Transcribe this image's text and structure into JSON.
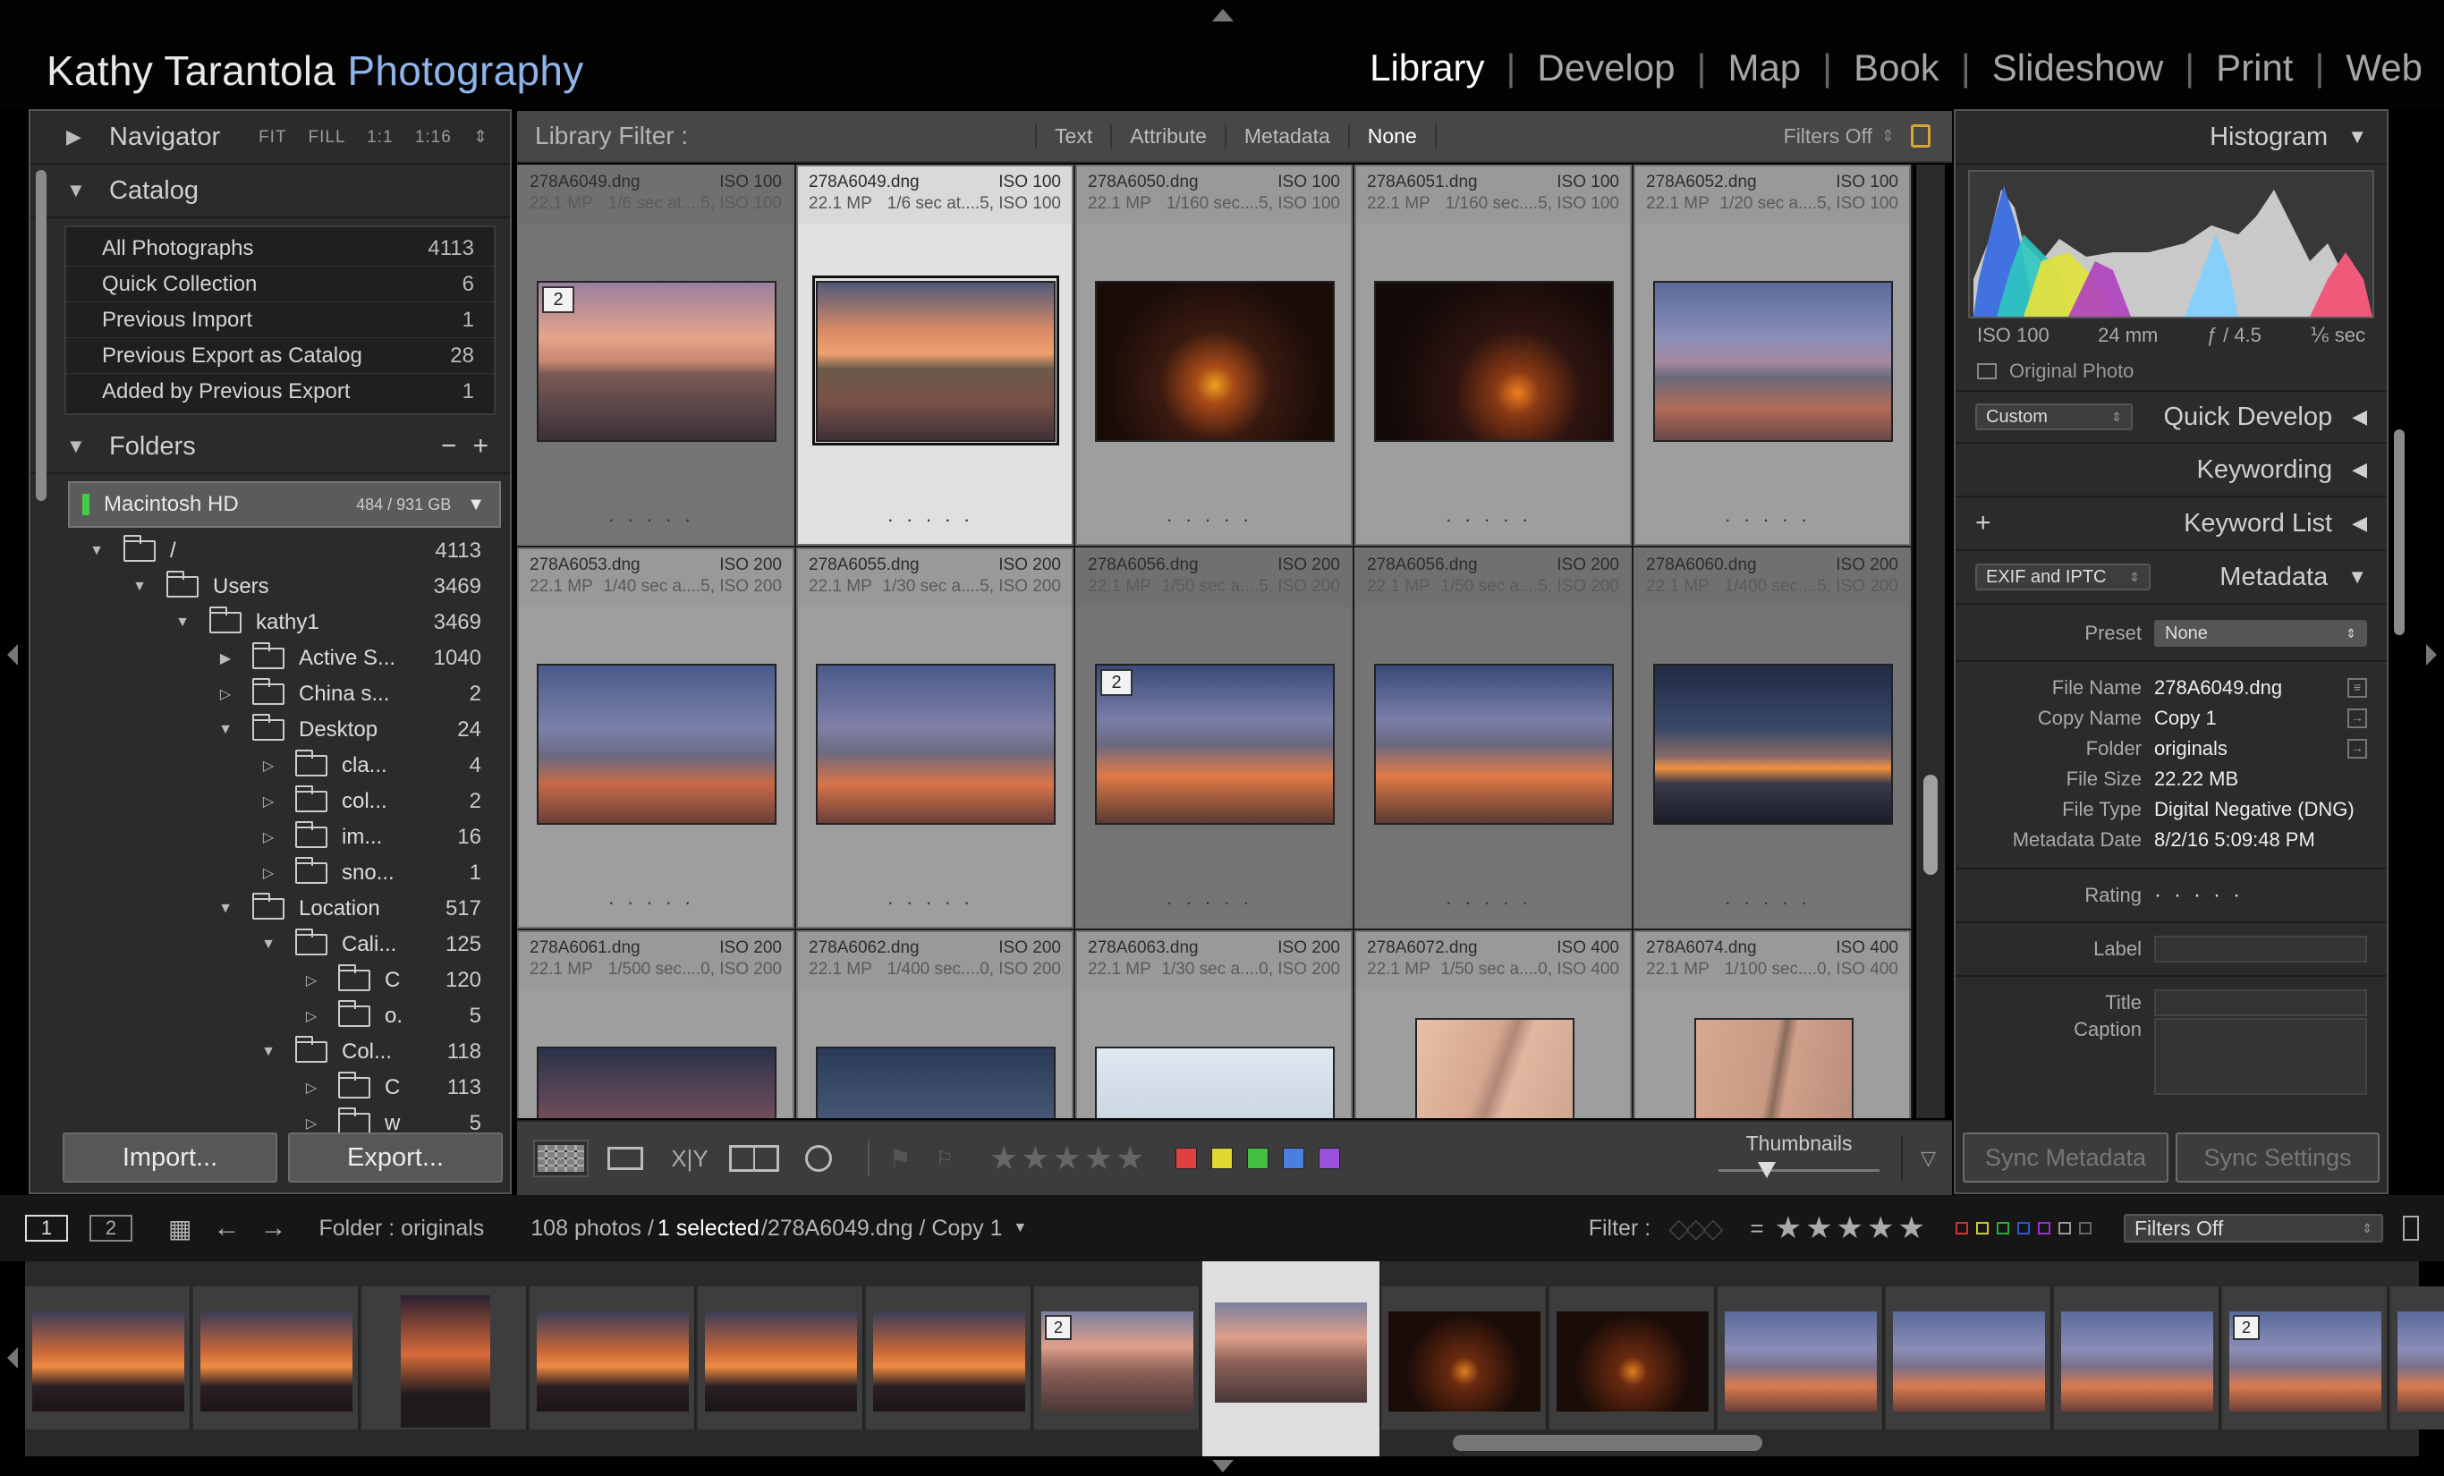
{
  "identity": {
    "name": "Kathy Tarantola",
    "brand": "Photography"
  },
  "modules": [
    "Library",
    "Develop",
    "Map",
    "Book",
    "Slideshow",
    "Print",
    "Web"
  ],
  "active_module": "Library",
  "navigator": {
    "title": "Navigator",
    "modes": [
      "FIT",
      "FILL",
      "1:1",
      "1:16"
    ]
  },
  "catalog": {
    "title": "Catalog",
    "items": [
      {
        "label": "All Photographs",
        "count": "4113"
      },
      {
        "label": "Quick Collection",
        "count": "6"
      },
      {
        "label": "Previous Import",
        "count": "1"
      },
      {
        "label": "Previous Export as Catalog",
        "count": "28"
      },
      {
        "label": "Added by Previous Export",
        "count": "1"
      }
    ]
  },
  "folders": {
    "title": "Folders",
    "volume": {
      "name": "Macintosh HD",
      "space": "484 / 931 GB"
    },
    "items": [
      {
        "label": "/",
        "count": "4113"
      },
      {
        "label": "Users",
        "count": "3469"
      },
      {
        "label": "kathy1",
        "count": "3469"
      },
      {
        "label": "Active S...",
        "count": "1040"
      },
      {
        "label": "China s...",
        "count": "2"
      },
      {
        "label": "Desktop",
        "count": "24"
      },
      {
        "label": "cla...",
        "count": "4"
      },
      {
        "label": "col...",
        "count": "2"
      },
      {
        "label": "im...",
        "count": "16"
      },
      {
        "label": "sno...",
        "count": "1"
      },
      {
        "label": "Location",
        "count": "517"
      },
      {
        "label": "Cali...",
        "count": "125"
      },
      {
        "label": "C",
        "count": "120"
      },
      {
        "label": "o.",
        "count": "5"
      },
      {
        "label": "Col...",
        "count": "118"
      },
      {
        "label": "C",
        "count": "113"
      },
      {
        "label": "w",
        "count": "5"
      }
    ]
  },
  "buttons": {
    "import": "Import...",
    "export": "Export..."
  },
  "library_filter": {
    "label": "Library Filter :",
    "options": [
      "Text",
      "Attribute",
      "Metadata",
      "None"
    ],
    "active": "None",
    "filters_off": "Filters Off"
  },
  "grid": [
    {
      "name": "278A6049.dng",
      "iso": "ISO 100",
      "mp": "22.1 MP",
      "exp": "1/6 sec at....5, ISO 100",
      "badge": "2"
    },
    {
      "name": "278A6049.dng",
      "iso": "ISO 100",
      "mp": "22.1 MP",
      "exp": "1/6 sec at....5, ISO 100",
      "badge": ""
    },
    {
      "name": "278A6050.dng",
      "iso": "ISO 100",
      "mp": "22.1 MP",
      "exp": "1/160 sec....5, ISO 100",
      "badge": ""
    },
    {
      "name": "278A6051.dng",
      "iso": "ISO 100",
      "mp": "22.1 MP",
      "exp": "1/160 sec....5, ISO 100",
      "badge": ""
    },
    {
      "name": "278A6052.dng",
      "iso": "ISO 100",
      "mp": "22.1 MP",
      "exp": "1/20 sec a....5, ISO 100",
      "badge": ""
    },
    {
      "name": "278A6053.dng",
      "iso": "ISO 200",
      "mp": "22.1 MP",
      "exp": "1/40 sec a....5, ISO 200",
      "badge": ""
    },
    {
      "name": "278A6055.dng",
      "iso": "ISO 200",
      "mp": "22.1 MP",
      "exp": "1/30 sec a....5, ISO 200",
      "badge": ""
    },
    {
      "name": "278A6056.dng",
      "iso": "ISO 200",
      "mp": "22.1 MP",
      "exp": "1/50 sec a....5, ISO 200",
      "badge": "2"
    },
    {
      "name": "278A6056.dng",
      "iso": "ISO 200",
      "mp": "22.1 MP",
      "exp": "1/50 sec a....5, ISO 200",
      "badge": ""
    },
    {
      "name": "278A6060.dng",
      "iso": "ISO 200",
      "mp": "22.1 MP",
      "exp": "1/400 sec....5, ISO 200",
      "badge": ""
    },
    {
      "name": "278A6061.dng",
      "iso": "ISO 200",
      "mp": "22.1 MP",
      "exp": "1/500 sec....0, ISO 200",
      "badge": ""
    },
    {
      "name": "278A6062.dng",
      "iso": "ISO 200",
      "mp": "22.1 MP",
      "exp": "1/400 sec....0, ISO 200",
      "badge": ""
    },
    {
      "name": "278A6063.dng",
      "iso": "ISO 200",
      "mp": "22.1 MP",
      "exp": "1/30 sec a....0, ISO 200",
      "badge": ""
    },
    {
      "name": "278A6072.dng",
      "iso": "ISO 400",
      "mp": "22.1 MP",
      "exp": "1/50 sec a....0, ISO 400",
      "badge": ""
    },
    {
      "name": "278A6074.dng",
      "iso": "ISO 400",
      "mp": "22.1 MP",
      "exp": "1/100 sec....0, ISO 400",
      "badge": ""
    }
  ],
  "toolbar": {
    "thumbnails_label": "Thumbnails",
    "thumbnail_size": 0.3,
    "color_labels": [
      "#e04040",
      "#e0d830",
      "#44c040",
      "#4a7fe0",
      "#9a50d8"
    ]
  },
  "histogram": {
    "title": "Histogram",
    "iso": "ISO 100",
    "focal": "24 mm",
    "aperture": "ƒ / 4.5",
    "shutter": "⅙ sec",
    "original_photo": "Original Photo"
  },
  "quick_develop": {
    "title": "Quick Develop",
    "preset": "Custom"
  },
  "keywording": {
    "title": "Keywording"
  },
  "keyword_list": {
    "title": "Keyword List"
  },
  "metadata": {
    "title": "Metadata",
    "view": "EXIF and IPTC",
    "preset_label": "Preset",
    "preset_value": "None",
    "fields": [
      {
        "k": "File Name",
        "v": "278A6049.dng"
      },
      {
        "k": "Copy Name",
        "v": "Copy 1"
      },
      {
        "k": "Folder",
        "v": "originals"
      },
      {
        "k": "File Size",
        "v": "22.22 MB"
      },
      {
        "k": "File Type",
        "v": "Digital Negative (DNG)"
      },
      {
        "k": "Metadata Date",
        "v": "8/2/16 5:09:48 PM"
      }
    ],
    "rating_label": "Rating",
    "label_label": "Label",
    "title_label": "Title",
    "caption_label": "Caption"
  },
  "sync": {
    "metadata": "Sync Metadata",
    "settings": "Sync Settings"
  },
  "secondary_bar": {
    "screen1": "1",
    "screen2": "2",
    "folder": "Folder : originals",
    "count": "108 photos /",
    "selected": "1 selected",
    "file": "/278A6049.dng / Copy 1",
    "filter_label": "Filter :",
    "filters_off": "Filters Off"
  },
  "filmstrip": [
    {
      "tone": "sunset",
      "badge": ""
    },
    {
      "tone": "sunset",
      "badge": ""
    },
    {
      "tone": "portrait",
      "badge": ""
    },
    {
      "tone": "sunset",
      "badge": ""
    },
    {
      "tone": "sunset",
      "badge": ""
    },
    {
      "tone": "sunset",
      "badge": ""
    },
    {
      "tone": "rocks",
      "badge": "2"
    },
    {
      "tone": "rocks",
      "badge": ""
    },
    {
      "tone": "forest",
      "badge": ""
    },
    {
      "tone": "forest",
      "badge": ""
    },
    {
      "tone": "coast",
      "badge": ""
    },
    {
      "tone": "coast",
      "badge": ""
    },
    {
      "tone": "coast",
      "badge": ""
    },
    {
      "tone": "coast",
      "badge": "2"
    },
    {
      "tone": "coast",
      "badge": ""
    }
  ]
}
